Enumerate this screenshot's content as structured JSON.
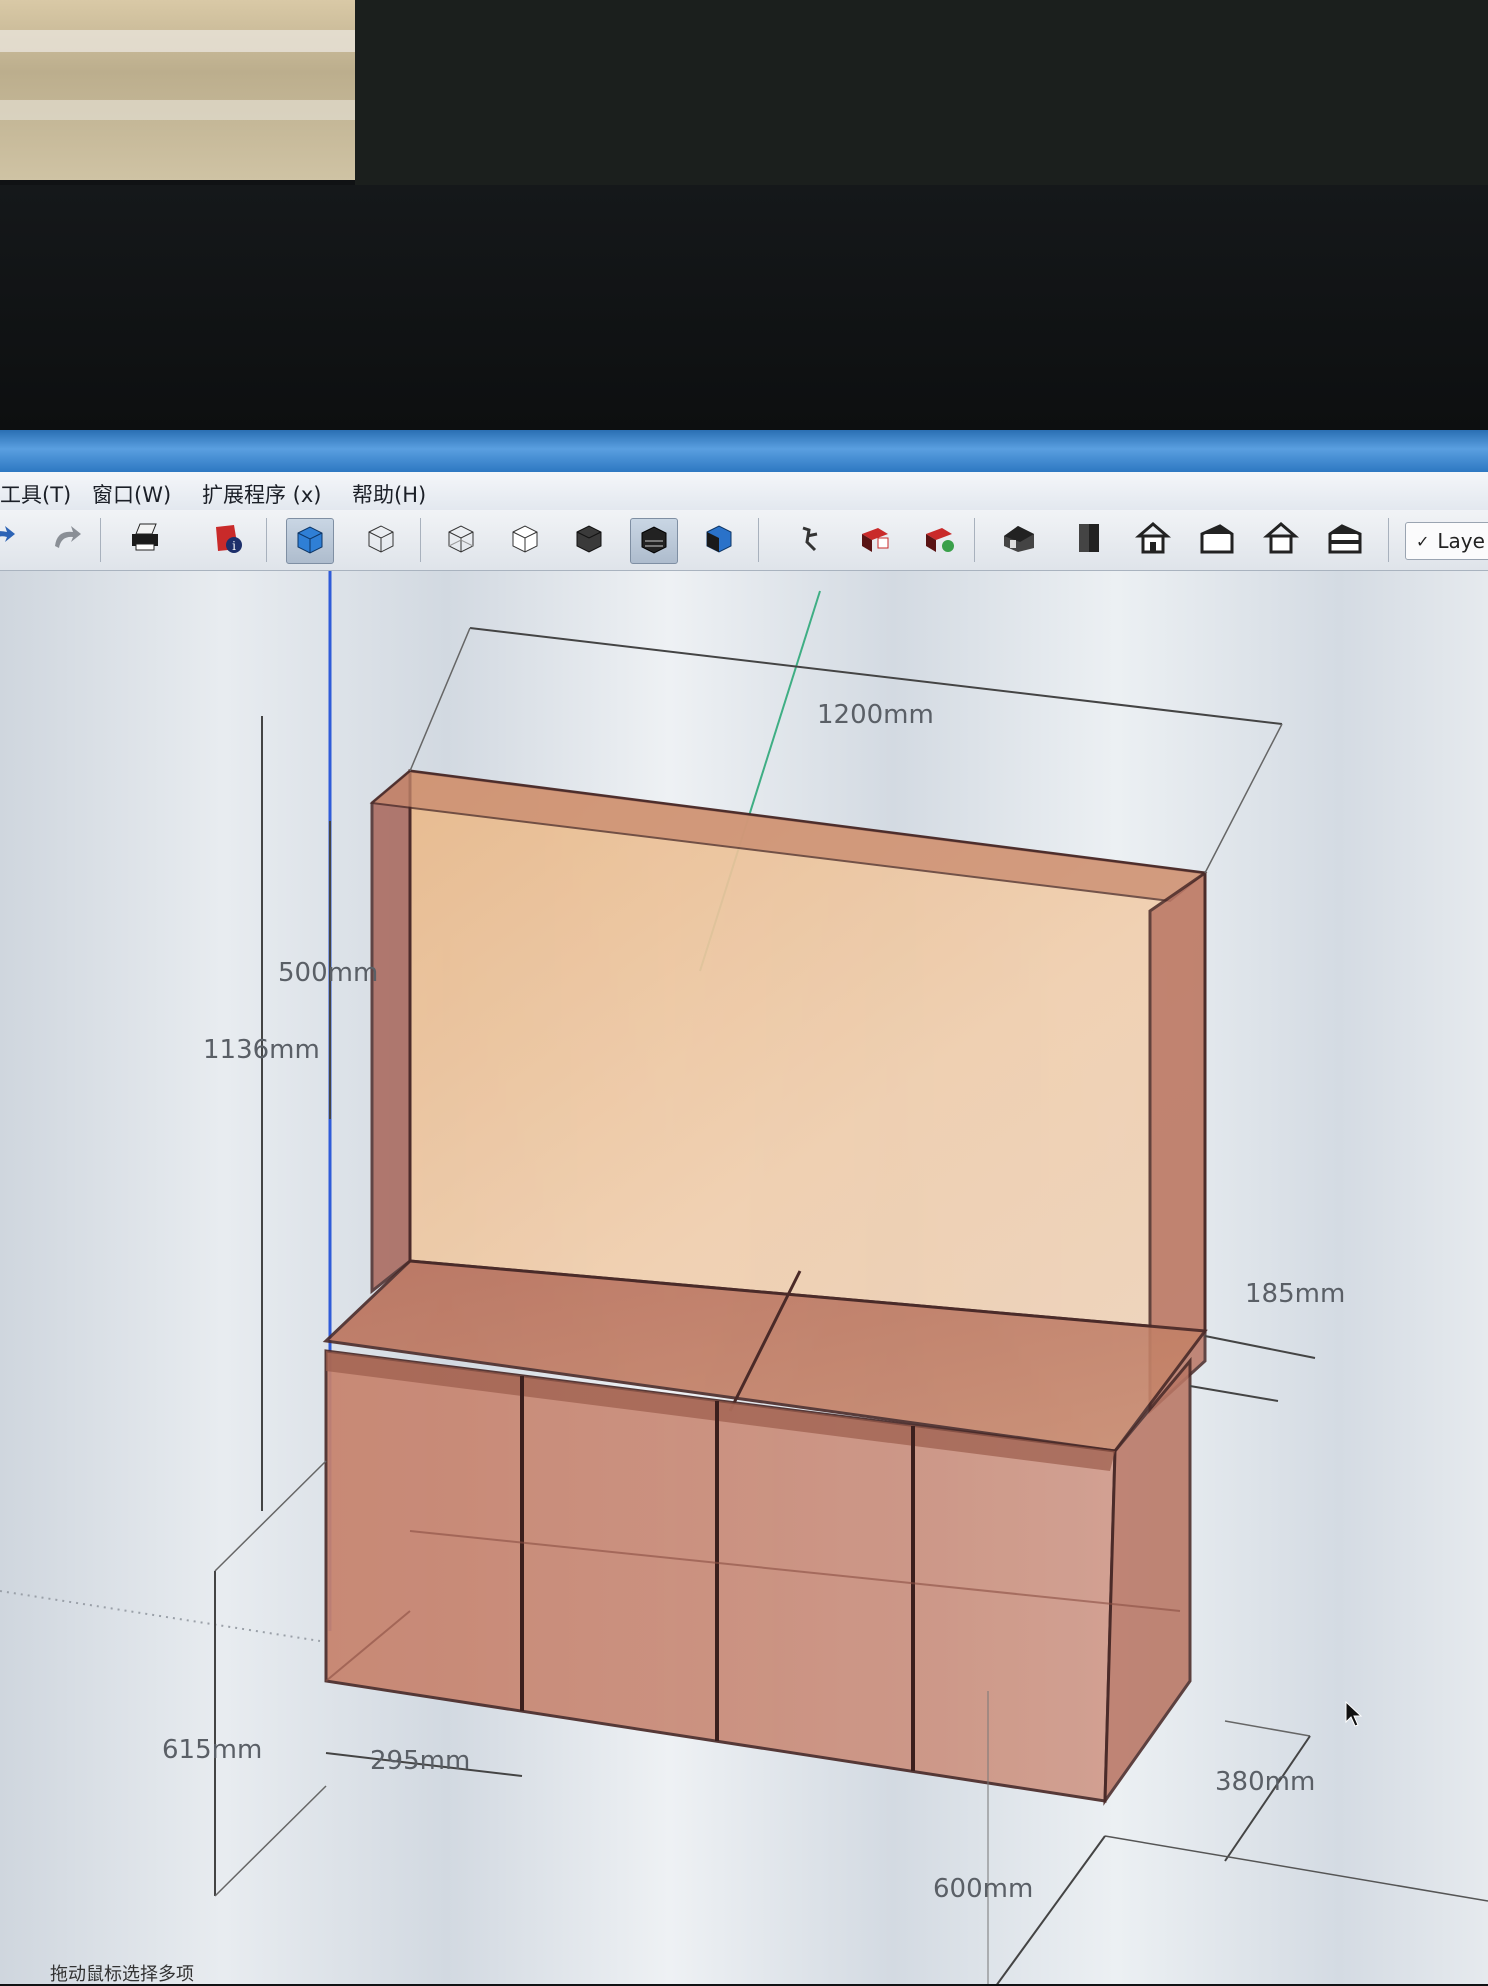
{
  "menu": {
    "items": [
      "工具(T)",
      "窗口(W)",
      "扩展程序 (x)",
      "帮助(H)"
    ]
  },
  "toolbar": {
    "buttons": [
      "redo-icon",
      "undo-icon",
      "print-icon",
      "model-info-icon",
      "xray-style-icon",
      "back-edges-style-icon",
      "wireframe-style-icon",
      "hidden-line-style-icon",
      "shaded-style-icon",
      "shaded-textures-style-icon",
      "monochrome-style-icon",
      "walk-icon",
      "section-plane-icon",
      "section-display-icon",
      "iso-view-icon",
      "top-view-icon",
      "front-view-icon",
      "right-view-icon",
      "back-view-icon",
      "left-view-icon"
    ],
    "layer_check": "✓",
    "layer_label": "Laye"
  },
  "dimensions": {
    "width_total": "1200mm",
    "height_total": "1136mm",
    "backboard_height": "500mm",
    "depth_top": "185mm",
    "cell_width": "295mm",
    "base_height": "615mm",
    "depth_bottom": "380mm",
    "cabinet_width": "600mm"
  },
  "status": {
    "text": "拖动鼠标选择多项"
  },
  "colors": {
    "wood": "#b9725d",
    "wood_light": "#e9b98a",
    "edge": "#4a2a28",
    "axis_blue": "#2f5bd8",
    "axis_green": "#3fae84"
  }
}
